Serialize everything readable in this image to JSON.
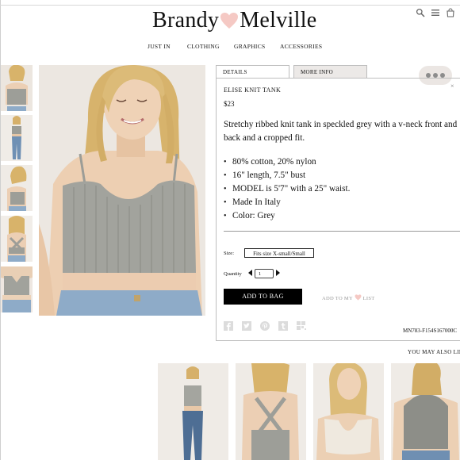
{
  "brand": {
    "name_left": "Brandy",
    "name_right": "Melville"
  },
  "header_icons": [
    "search-icon",
    "menu-icon"
  ],
  "nav": {
    "items": [
      "JUST IN",
      "CLOTHING",
      "GRAPHICS",
      "ACCESSORIES"
    ]
  },
  "tabs": {
    "details": "DETAILS",
    "more_info": "MORE INFO"
  },
  "product": {
    "name": "ELISE KNIT TANK",
    "price": "$23",
    "description": "Stretchy ribbed knit tank in speckled grey with a v-neck front and back and a cropped fit.",
    "bullets": [
      "80% cotton, 20% nylon",
      "16\" length, 7.5\" bust",
      "MODEL is 5'7\" with a 25\" waist.",
      "Made In Italy",
      "Color: Grey"
    ],
    "size_label": "Size:",
    "size_option": "Fits size X-small/Small",
    "quantity_label": "Quantity",
    "quantity_value": "1",
    "add_to_bag": "ADD TO BAG",
    "wishlist_left": "ADD TO MY",
    "wishlist_right": "LIST",
    "sku": "MN783-F154S167000C"
  },
  "social_icons": [
    "facebook-icon",
    "twitter-icon",
    "pinterest-icon",
    "tumblr-icon",
    "wanelo-icon"
  ],
  "recommendations": {
    "heading": "YOU MAY ALSO LIKE"
  },
  "colors": {
    "heart_pink": "#f5c9c4",
    "tab_grey": "#ece9e7",
    "button_black": "#000000"
  }
}
